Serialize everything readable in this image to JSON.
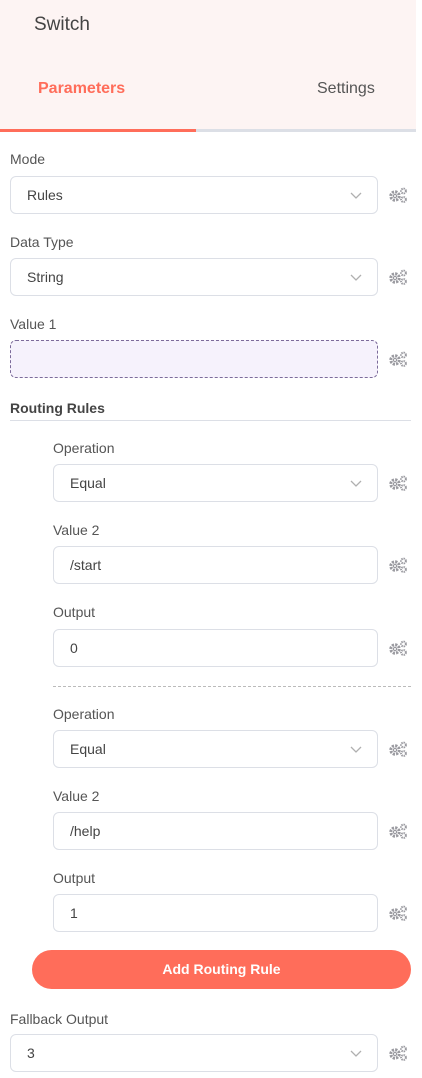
{
  "header": {
    "title": "Switch"
  },
  "tabs": {
    "parameters": "Parameters",
    "settings": "Settings"
  },
  "mode": {
    "label": "Mode",
    "value": "Rules"
  },
  "data_type": {
    "label": "Data Type",
    "value": "String"
  },
  "value1": {
    "label": "Value 1",
    "value": ""
  },
  "routing_rules": {
    "label": "Routing Rules",
    "rules": [
      {
        "operation_label": "Operation",
        "operation": "Equal",
        "value2_label": "Value 2",
        "value2": "/start",
        "output_label": "Output",
        "output": "0"
      },
      {
        "operation_label": "Operation",
        "operation": "Equal",
        "value2_label": "Value 2",
        "value2": "/help",
        "output_label": "Output",
        "output": "1"
      }
    ],
    "add_button": "Add Routing Rule"
  },
  "fallback": {
    "label": "Fallback Output",
    "value": "3"
  },
  "colors": {
    "accent": "#ff6d5a",
    "header_bg": "#fdf4f3",
    "dashed_field_bg": "#f6f2fc"
  },
  "icons": {
    "options": "gears-icon",
    "dropdown": "chevron-down-icon"
  }
}
